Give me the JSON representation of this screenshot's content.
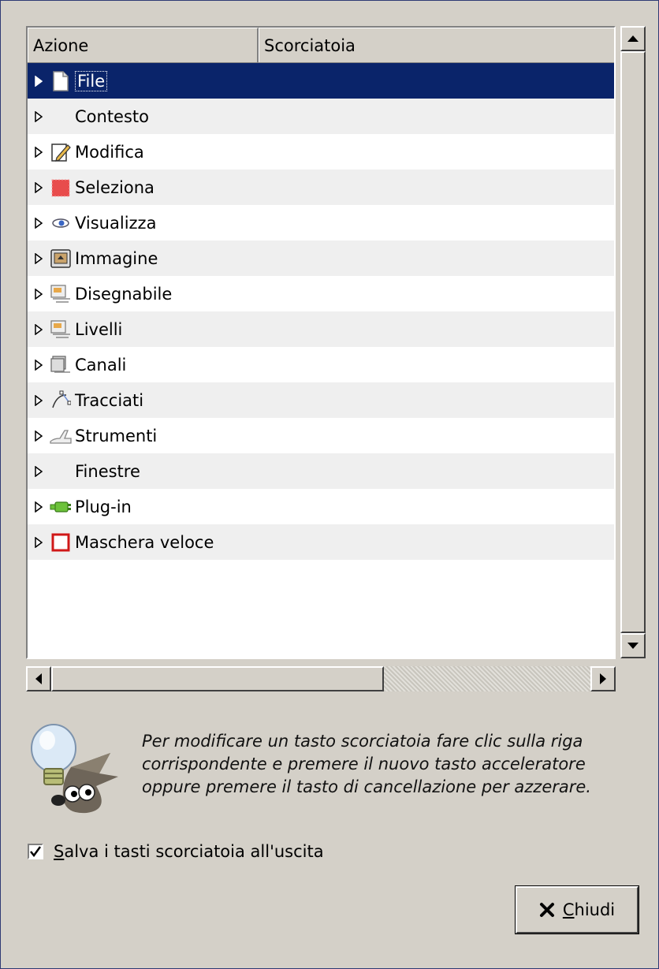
{
  "tree": {
    "columns": [
      "Azione",
      "Scorciatoia"
    ],
    "rows": [
      {
        "label": "File",
        "icon": "file-icon",
        "selected": true
      },
      {
        "label": "Contesto",
        "icon": "none"
      },
      {
        "label": "Modifica",
        "icon": "edit-icon"
      },
      {
        "label": "Seleziona",
        "icon": "selection-icon"
      },
      {
        "label": "Visualizza",
        "icon": "eye-icon"
      },
      {
        "label": "Immagine",
        "icon": "image-icon"
      },
      {
        "label": "Disegnabile",
        "icon": "drawable-icon"
      },
      {
        "label": "Livelli",
        "icon": "layers-icon"
      },
      {
        "label": "Canali",
        "icon": "channels-icon"
      },
      {
        "label": "Tracciati",
        "icon": "paths-icon"
      },
      {
        "label": "Strumenti",
        "icon": "tools-icon"
      },
      {
        "label": "Finestre",
        "icon": "none"
      },
      {
        "label": "Plug-in",
        "icon": "plugin-icon"
      },
      {
        "label": "Maschera veloce",
        "icon": "quickmask-icon"
      }
    ]
  },
  "hint": {
    "icon": "gimp-tip-icon",
    "lines": [
      "Per modificare un tasto scorciatoia fare clic sulla riga",
      "corrispondente e premere il nuovo tasto acceleratore",
      "oppure premere il tasto di cancellazione per azzerare."
    ]
  },
  "save_option": {
    "mnemonic": "S",
    "label_rest": "alva i tasti scorciatoia all'uscita",
    "checked": true
  },
  "close_button": {
    "mnemonic": "C",
    "label_rest": "hiudi",
    "icon": "close-icon"
  },
  "colors": {
    "selection": "#0a246a",
    "window_bg": "#d4d0c8",
    "alt_row": "#efefef"
  }
}
